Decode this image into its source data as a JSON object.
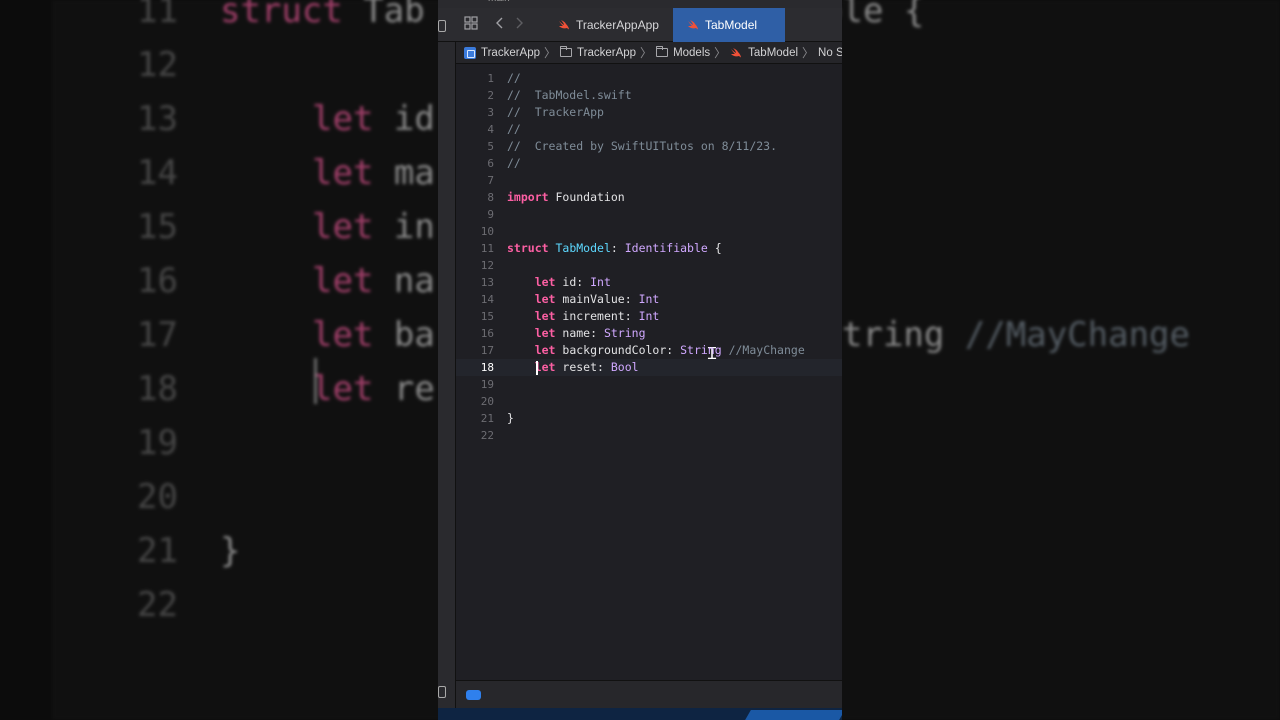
{
  "background_view": {
    "lines": [
      {
        "num": "11",
        "text": "struct Tab",
        "kind": "kw-partial"
      },
      {
        "num": "12",
        "text": ""
      },
      {
        "num": "13",
        "text": "let id"
      },
      {
        "num": "14",
        "text": "let ma"
      },
      {
        "num": "15",
        "text": "let in"
      },
      {
        "num": "16",
        "text": "let na"
      },
      {
        "num": "17",
        "text": "let ba",
        "tail": "tring //MayChange"
      },
      {
        "num": "18",
        "text": "let re"
      },
      {
        "num": "19",
        "text": ""
      },
      {
        "num": "20",
        "text": ""
      },
      {
        "num": "21",
        "text": "}"
      },
      {
        "num": "22",
        "text": ""
      }
    ],
    "tail_17": "tring //MayChange",
    "head_11": "ole {"
  },
  "window": {
    "title_fragment": "main"
  },
  "tabs": [
    {
      "label": "TrackerAppApp",
      "active": false
    },
    {
      "label": "TabModel",
      "active": true
    }
  ],
  "breadcrumb": {
    "items": [
      "TrackerApp",
      "TrackerApp",
      "Models",
      "TabModel",
      "No Sele"
    ]
  },
  "editor": {
    "active_line": 18,
    "lines": [
      {
        "n": "1",
        "parts": [
          {
            "t": "//",
            "c": "cm"
          }
        ]
      },
      {
        "n": "2",
        "parts": [
          {
            "t": "//  TabModel.swift",
            "c": "cm"
          }
        ]
      },
      {
        "n": "3",
        "parts": [
          {
            "t": "//  TrackerApp",
            "c": "cm"
          }
        ]
      },
      {
        "n": "4",
        "parts": [
          {
            "t": "//",
            "c": "cm"
          }
        ]
      },
      {
        "n": "5",
        "parts": [
          {
            "t": "//  Created by SwiftUITutos on 8/11/23.",
            "c": "cm"
          }
        ]
      },
      {
        "n": "6",
        "parts": [
          {
            "t": "//",
            "c": "cm"
          }
        ]
      },
      {
        "n": "7",
        "parts": []
      },
      {
        "n": "8",
        "parts": [
          {
            "t": "import",
            "c": "kw"
          },
          {
            "t": " Foundation",
            "c": ""
          }
        ]
      },
      {
        "n": "9",
        "parts": []
      },
      {
        "n": "10",
        "parts": []
      },
      {
        "n": "11",
        "parts": [
          {
            "t": "struct",
            "c": "kw"
          },
          {
            "t": " ",
            "c": ""
          },
          {
            "t": "TabModel",
            "c": "ty-decl"
          },
          {
            "t": ": ",
            "c": ""
          },
          {
            "t": "Identifiable",
            "c": "ty"
          },
          {
            "t": " {",
            "c": ""
          }
        ]
      },
      {
        "n": "12",
        "parts": []
      },
      {
        "n": "13",
        "parts": [
          {
            "t": "    ",
            "c": ""
          },
          {
            "t": "let",
            "c": "kw"
          },
          {
            "t": " id: ",
            "c": ""
          },
          {
            "t": "Int",
            "c": "ty"
          }
        ]
      },
      {
        "n": "14",
        "parts": [
          {
            "t": "    ",
            "c": ""
          },
          {
            "t": "let",
            "c": "kw"
          },
          {
            "t": " mainValue: ",
            "c": ""
          },
          {
            "t": "Int",
            "c": "ty"
          }
        ]
      },
      {
        "n": "15",
        "parts": [
          {
            "t": "    ",
            "c": ""
          },
          {
            "t": "let",
            "c": "kw"
          },
          {
            "t": " increment: ",
            "c": ""
          },
          {
            "t": "Int",
            "c": "ty"
          }
        ]
      },
      {
        "n": "16",
        "parts": [
          {
            "t": "    ",
            "c": ""
          },
          {
            "t": "let",
            "c": "kw"
          },
          {
            "t": " name: ",
            "c": ""
          },
          {
            "t": "String",
            "c": "ty"
          }
        ]
      },
      {
        "n": "17",
        "parts": [
          {
            "t": "    ",
            "c": ""
          },
          {
            "t": "let",
            "c": "kw"
          },
          {
            "t": " backgroundColor: ",
            "c": ""
          },
          {
            "t": "String",
            "c": "ty"
          },
          {
            "t": " //MayChange",
            "c": "cm"
          }
        ]
      },
      {
        "n": "18",
        "parts": [
          {
            "t": "    ",
            "c": ""
          },
          {
            "t": "let",
            "c": "kw"
          },
          {
            "t": " reset: ",
            "c": ""
          },
          {
            "t": "Bool",
            "c": "ty"
          }
        ]
      },
      {
        "n": "19",
        "parts": []
      },
      {
        "n": "20",
        "parts": []
      },
      {
        "n": "21",
        "parts": [
          {
            "t": "}",
            "c": ""
          }
        ]
      },
      {
        "n": "22",
        "parts": []
      }
    ]
  },
  "colors": {
    "keyword": "#fc5fa3",
    "comment": "#7f8c98",
    "type_declaration": "#5dd8ff",
    "type_reference": "#d0a8ff",
    "active_tab": "#2f5fa6",
    "accent": "#2f80ed"
  },
  "icons": {
    "grid": "grid-icon",
    "back": "chevron-left-icon",
    "forward": "chevron-right-icon",
    "swift": "swift-file-icon",
    "project": "xcode-project-icon",
    "folder": "folder-icon"
  }
}
